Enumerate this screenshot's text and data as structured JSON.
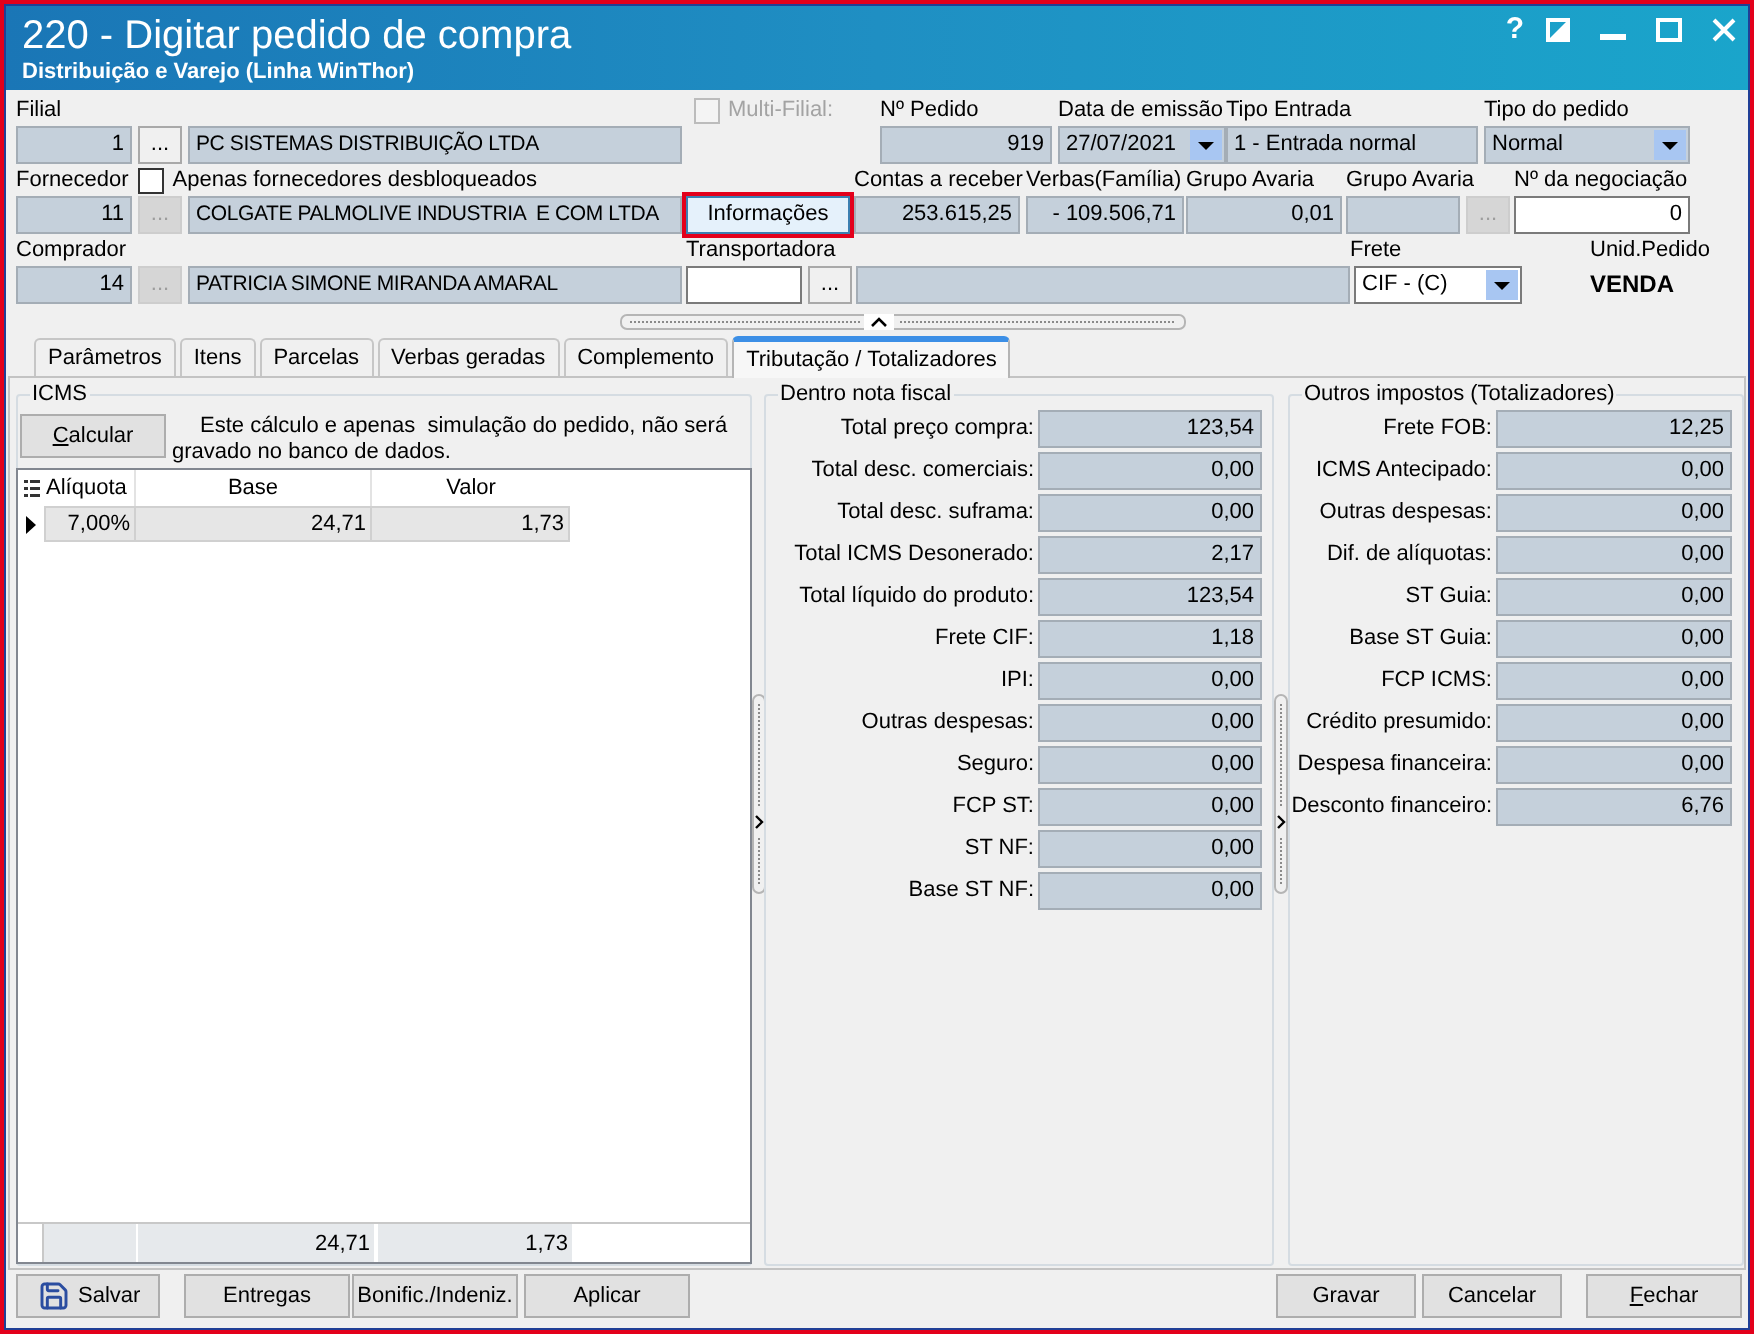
{
  "window": {
    "title": "220 - Digitar pedido de compra",
    "subtitle": "Distribuição e Varejo (Linha WinThor)",
    "help": "?"
  },
  "header": {
    "filial": {
      "label": "Filial",
      "code": "1",
      "lookup": "...",
      "lookup_disabled": false,
      "name": "PC SISTEMAS DISTRIBUIÇÃO LTDA"
    },
    "multi_filial": {
      "label": "Multi-Filial:",
      "checked": false,
      "disabled": true
    },
    "numero_pedido": {
      "label": "Nº Pedido",
      "value": "919",
      "editable": false
    },
    "data_emissao": {
      "label": "Data de emissão",
      "value": "27/07/2021",
      "editable": false
    },
    "tipo_entrada": {
      "label": "Tipo Entrada",
      "value": "1 - Entrada normal",
      "editable": false
    },
    "tipo_pedido": {
      "label": "Tipo do pedido",
      "value": "Normal",
      "editable": false
    },
    "fornecedor": {
      "label": "Fornecedor",
      "code": "11",
      "lookup": "...",
      "lookup_disabled": true,
      "name": "COLGATE PALMOLIVE INDUSTRIA  E COM LTDA"
    },
    "apenas_desbloqueados": {
      "label": "Apenas fornecedores desbloqueados",
      "checked": false
    },
    "informacoes": {
      "label": "Informações",
      "highlighted": true
    },
    "contas_a_receber": {
      "label": "Contas a receber",
      "value": "253.615,25",
      "editable": false
    },
    "verbas_familia": {
      "label": "Verbas(Família)",
      "value": "- 109.506,71",
      "editable": false
    },
    "grupo_avaria": {
      "label": "Grupo Avaria",
      "value": "0,01",
      "editable": false
    },
    "grupo_avaria_lookup": {
      "label": "Grupo Avaria",
      "lookup": "...",
      "lookup_disabled": true,
      "editable": false
    },
    "negociacao": {
      "label": "Nº da negociação",
      "value": "0",
      "editable": true
    },
    "comprador": {
      "label": "Comprador",
      "code": "14",
      "lookup": "...",
      "lookup_disabled": true,
      "name": "PATRICIA SIMONE MIRANDA AMARAL"
    },
    "transportadora": {
      "label": "Transportadora",
      "lookup": "...",
      "lookup_disabled": false,
      "editable": true
    },
    "frete": {
      "label": "Frete",
      "value": "CIF - (C)",
      "editable": true
    },
    "unid_pedido": {
      "label": "Unid.Pedido",
      "value": "VENDA"
    }
  },
  "tabs": [
    {
      "label": "Parâmetros",
      "selected": false
    },
    {
      "label": "Itens",
      "selected": false
    },
    {
      "label": "Parcelas",
      "selected": false
    },
    {
      "label": "Verbas geradas",
      "selected": false
    },
    {
      "label": "Complemento",
      "selected": false
    },
    {
      "label": "Tributação / Totalizadores",
      "selected": true
    }
  ],
  "icms": {
    "title": "ICMS",
    "calculate_button": {
      "label": "Calcular",
      "mnemonic": true
    },
    "note": "Este cálculo e apenas  simulação do pedido, não será gravado no banco de dados.",
    "table": {
      "columns": [
        "Alíquota",
        "Base",
        "Valor"
      ],
      "rows": [
        {
          "cells": [
            "7,00%",
            "24,71",
            "1,73"
          ],
          "current": true
        }
      ],
      "totals": [
        "24,71",
        "1,73"
      ]
    }
  },
  "dentro_nota_fiscal": {
    "title": "Dentro nota fiscal",
    "rows": [
      {
        "label": "Total preço compra:",
        "value": "123,54"
      },
      {
        "label": "Total desc. comerciais:",
        "value": "0,00"
      },
      {
        "label": "Total desc. suframa:",
        "value": "0,00"
      },
      {
        "label": "Total ICMS Desonerado:",
        "value": "2,17"
      },
      {
        "label": "Total líquido do produto:",
        "value": "123,54"
      },
      {
        "label": "Frete CIF:",
        "value": "1,18"
      },
      {
        "label": "IPI:",
        "value": "0,00"
      },
      {
        "label": "Outras despesas:",
        "value": "0,00"
      },
      {
        "label": "Seguro:",
        "value": "0,00"
      },
      {
        "label": "FCP ST:",
        "value": "0,00"
      },
      {
        "label": "ST NF:",
        "value": "0,00"
      },
      {
        "label": "Base ST NF:",
        "value": "0,00"
      }
    ]
  },
  "outros_impostos": {
    "title": "Outros impostos (Totalizadores)",
    "rows": [
      {
        "label": "Frete FOB:",
        "value": "12,25"
      },
      {
        "label": "ICMS Antecipado:",
        "value": "0,00"
      },
      {
        "label": "Outras despesas:",
        "value": "0,00"
      },
      {
        "label": "Dif. de alíquotas:",
        "value": "0,00"
      },
      {
        "label": "ST Guia:",
        "value": "0,00"
      },
      {
        "label": "Base ST Guia:",
        "value": "0,00"
      },
      {
        "label": "FCP ICMS:",
        "value": "0,00"
      },
      {
        "label": "Crédito presumido:",
        "value": "0,00"
      },
      {
        "label": "Despesa financeira:",
        "value": "0,00"
      },
      {
        "label": "Desconto financeiro:",
        "value": "6,76"
      }
    ]
  },
  "footer": {
    "left_buttons": [
      {
        "label": "Salvar",
        "kind": "icon"
      },
      {
        "label": "Entregas",
        "kind": "text"
      },
      {
        "label": "Bonific./Indeniz.",
        "kind": "text"
      },
      {
        "label": "Aplicar",
        "kind": "text"
      }
    ],
    "right_buttons": [
      {
        "label": "Gravar",
        "mnemonic": false
      },
      {
        "label": "Cancelar",
        "mnemonic": false
      },
      {
        "label": "Fechar",
        "mnemonic": true
      }
    ]
  }
}
